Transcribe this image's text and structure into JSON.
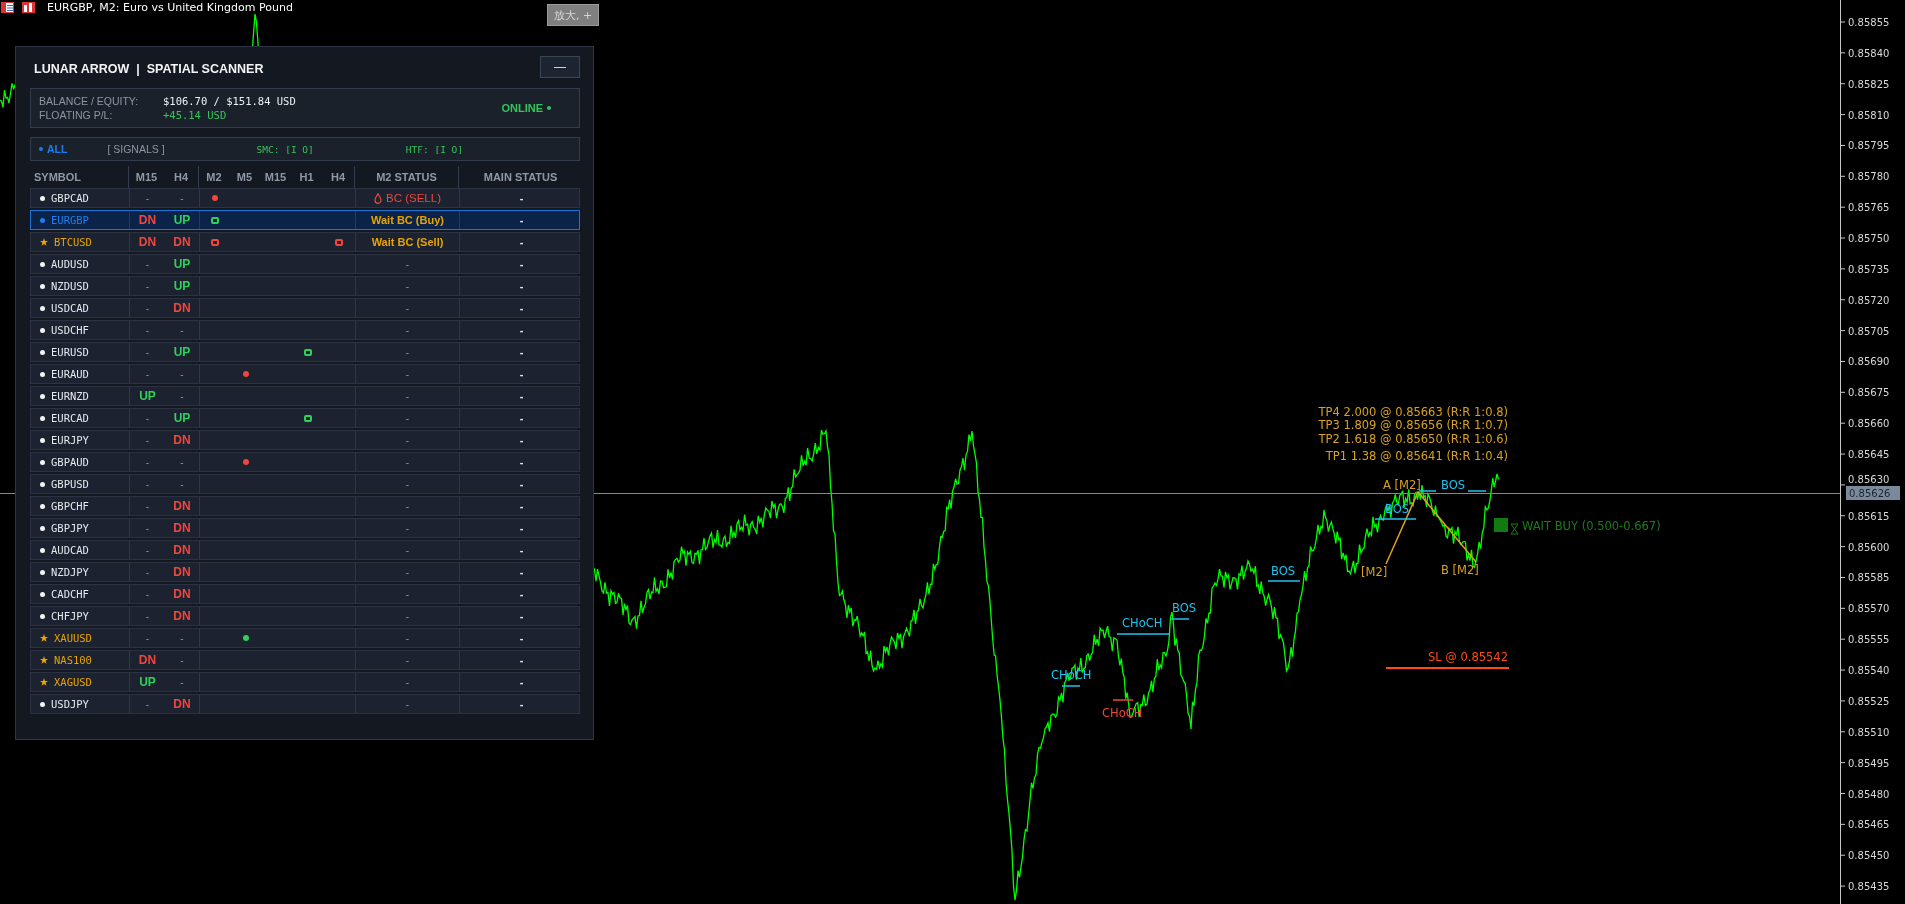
{
  "window": {
    "title": "EURGBP, M2:  Euro vs United Kingdom Pound",
    "zoom_button": "放大, +"
  },
  "scanner": {
    "title": "LUNAR ARROW  |  SPATIAL SCANNER",
    "minimize": "—",
    "account": {
      "balance_label": "BALANCE / EQUITY:",
      "balance_value": "$106.70 / $151.84 USD",
      "pl_label": "FLOATING P/L:",
      "pl_value": "+45.14 USD",
      "status": "ONLINE"
    },
    "filters": [
      {
        "label": "ALL",
        "selected": true
      },
      {
        "label": "[ SIGNALS ]",
        "selected": false
      }
    ],
    "smc": "SMC: [I O]",
    "htf": "HTF: [I O]",
    "columns": [
      "SYMBOL",
      "M15",
      "H4",
      "M2",
      "M5",
      "M15",
      "H1",
      "H4",
      "M2 STATUS",
      "MAIN STATUS"
    ],
    "rows": [
      {
        "symbol": "GBPCAD",
        "kind": "dot",
        "selected": false,
        "m15": {
          "text": "-",
          "kind": "none"
        },
        "h4": {
          "text": "-",
          "kind": "none"
        },
        "signals": {
          "m2": {
            "kind": "filled",
            "color": "#f0463c"
          }
        },
        "status": {
          "text": "BC (SELL)",
          "kind": "sell"
        },
        "main": "-"
      },
      {
        "symbol": "EURGBP",
        "kind": "dot",
        "selected": true,
        "m15": {
          "text": "DN",
          "kind": "down"
        },
        "h4": {
          "text": "UP",
          "kind": "up"
        },
        "signals": {
          "m2": {
            "kind": "hollow",
            "color": "#2fd15a"
          }
        },
        "status": {
          "text": "Wait BC (Buy)",
          "kind": "wait"
        },
        "main": "-"
      },
      {
        "symbol": "BTCUSD",
        "kind": "star",
        "selected": false,
        "m15": {
          "text": "DN",
          "kind": "down"
        },
        "h4": {
          "text": "DN",
          "kind": "down"
        },
        "signals": {
          "m2": {
            "kind": "hollow",
            "color": "#f0463c"
          },
          "h4": {
            "kind": "hollow",
            "color": "#f0463c"
          }
        },
        "status": {
          "text": "Wait BC (Sell)",
          "kind": "wait"
        },
        "main": "-"
      },
      {
        "symbol": "AUDUSD",
        "kind": "dot",
        "selected": false,
        "m15": {
          "text": "-",
          "kind": "none"
        },
        "h4": {
          "text": "UP",
          "kind": "up"
        },
        "signals": {},
        "status": {
          "text": "-",
          "kind": "none"
        },
        "main": "-"
      },
      {
        "symbol": "NZDUSD",
        "kind": "dot",
        "selected": false,
        "m15": {
          "text": "-",
          "kind": "none"
        },
        "h4": {
          "text": "UP",
          "kind": "up"
        },
        "signals": {},
        "status": {
          "text": "-",
          "kind": "none"
        },
        "main": "-"
      },
      {
        "symbol": "USDCAD",
        "kind": "dot",
        "selected": false,
        "m15": {
          "text": "-",
          "kind": "none"
        },
        "h4": {
          "text": "DN",
          "kind": "down"
        },
        "signals": {},
        "status": {
          "text": "-",
          "kind": "none"
        },
        "main": "-"
      },
      {
        "symbol": "USDCHF",
        "kind": "dot",
        "selected": false,
        "m15": {
          "text": "-",
          "kind": "none"
        },
        "h4": {
          "text": "-",
          "kind": "none"
        },
        "signals": {},
        "status": {
          "text": "-",
          "kind": "none"
        },
        "main": "-"
      },
      {
        "symbol": "EURUSD",
        "kind": "dot",
        "selected": false,
        "m15": {
          "text": "-",
          "kind": "none"
        },
        "h4": {
          "text": "UP",
          "kind": "up"
        },
        "signals": {
          "h1": {
            "kind": "hollow",
            "color": "#2fd15a"
          }
        },
        "status": {
          "text": "-",
          "kind": "none"
        },
        "main": "-"
      },
      {
        "symbol": "EURAUD",
        "kind": "dot",
        "selected": false,
        "m15": {
          "text": "-",
          "kind": "none"
        },
        "h4": {
          "text": "-",
          "kind": "none"
        },
        "signals": {
          "m5": {
            "kind": "filled",
            "color": "#f0463c"
          }
        },
        "status": {
          "text": "-",
          "kind": "none"
        },
        "main": "-"
      },
      {
        "symbol": "EURNZD",
        "kind": "dot",
        "selected": false,
        "m15": {
          "text": "UP",
          "kind": "up"
        },
        "h4": {
          "text": "-",
          "kind": "none"
        },
        "signals": {},
        "status": {
          "text": "-",
          "kind": "none"
        },
        "main": "-"
      },
      {
        "symbol": "EURCAD",
        "kind": "dot",
        "selected": false,
        "m15": {
          "text": "-",
          "kind": "none"
        },
        "h4": {
          "text": "UP",
          "kind": "up"
        },
        "signals": {
          "h1": {
            "kind": "hollow",
            "color": "#2fd15a"
          }
        },
        "status": {
          "text": "-",
          "kind": "none"
        },
        "main": "-"
      },
      {
        "symbol": "EURJPY",
        "kind": "dot",
        "selected": false,
        "m15": {
          "text": "-",
          "kind": "none"
        },
        "h4": {
          "text": "DN",
          "kind": "down"
        },
        "signals": {},
        "status": {
          "text": "-",
          "kind": "none"
        },
        "main": "-"
      },
      {
        "symbol": "GBPAUD",
        "kind": "dot",
        "selected": false,
        "m15": {
          "text": "-",
          "kind": "none"
        },
        "h4": {
          "text": "-",
          "kind": "none"
        },
        "signals": {
          "m5": {
            "kind": "filled",
            "color": "#f0463c"
          }
        },
        "status": {
          "text": "-",
          "kind": "none"
        },
        "main": "-"
      },
      {
        "symbol": "GBPUSD",
        "kind": "dot",
        "selected": false,
        "m15": {
          "text": "-",
          "kind": "none"
        },
        "h4": {
          "text": "-",
          "kind": "none"
        },
        "signals": {},
        "status": {
          "text": "-",
          "kind": "none"
        },
        "main": "-"
      },
      {
        "symbol": "GBPCHF",
        "kind": "dot",
        "selected": false,
        "m15": {
          "text": "-",
          "kind": "none"
        },
        "h4": {
          "text": "DN",
          "kind": "down"
        },
        "signals": {},
        "status": {
          "text": "-",
          "kind": "none"
        },
        "main": "-"
      },
      {
        "symbol": "GBPJPY",
        "kind": "dot",
        "selected": false,
        "m15": {
          "text": "-",
          "kind": "none"
        },
        "h4": {
          "text": "DN",
          "kind": "down"
        },
        "signals": {},
        "status": {
          "text": "-",
          "kind": "none"
        },
        "main": "-"
      },
      {
        "symbol": "AUDCAD",
        "kind": "dot",
        "selected": false,
        "m15": {
          "text": "-",
          "kind": "none"
        },
        "h4": {
          "text": "DN",
          "kind": "down"
        },
        "signals": {},
        "status": {
          "text": "-",
          "kind": "none"
        },
        "main": "-"
      },
      {
        "symbol": "NZDJPY",
        "kind": "dot",
        "selected": false,
        "m15": {
          "text": "-",
          "kind": "none"
        },
        "h4": {
          "text": "DN",
          "kind": "down"
        },
        "signals": {},
        "status": {
          "text": "-",
          "kind": "none"
        },
        "main": "-"
      },
      {
        "symbol": "CADCHF",
        "kind": "dot",
        "selected": false,
        "m15": {
          "text": "-",
          "kind": "none"
        },
        "h4": {
          "text": "DN",
          "kind": "down"
        },
        "signals": {},
        "status": {
          "text": "-",
          "kind": "none"
        },
        "main": "-"
      },
      {
        "symbol": "CHFJPY",
        "kind": "dot",
        "selected": false,
        "m15": {
          "text": "-",
          "kind": "none"
        },
        "h4": {
          "text": "DN",
          "kind": "down"
        },
        "signals": {},
        "status": {
          "text": "-",
          "kind": "none"
        },
        "main": "-"
      },
      {
        "symbol": "XAUUSD",
        "kind": "star",
        "selected": false,
        "m15": {
          "text": "-",
          "kind": "none"
        },
        "h4": {
          "text": "-",
          "kind": "none"
        },
        "signals": {
          "m5": {
            "kind": "filled",
            "color": "#2fd15a"
          }
        },
        "status": {
          "text": "-",
          "kind": "none"
        },
        "main": "-"
      },
      {
        "symbol": "NAS100",
        "kind": "star",
        "selected": false,
        "m15": {
          "text": "DN",
          "kind": "down"
        },
        "h4": {
          "text": "-",
          "kind": "none"
        },
        "signals": {},
        "status": {
          "text": "-",
          "kind": "none"
        },
        "main": "-"
      },
      {
        "symbol": "XAGUSD",
        "kind": "star",
        "selected": false,
        "m15": {
          "text": "UP",
          "kind": "up"
        },
        "h4": {
          "text": "-",
          "kind": "none"
        },
        "signals": {},
        "status": {
          "text": "-",
          "kind": "none"
        },
        "main": "-"
      },
      {
        "symbol": "USDJPY",
        "kind": "dot",
        "selected": false,
        "m15": {
          "text": "-",
          "kind": "none"
        },
        "h4": {
          "text": "DN",
          "kind": "down"
        },
        "signals": {},
        "status": {
          "text": "-",
          "kind": "none"
        },
        "main": "-"
      }
    ]
  },
  "chart": {
    "annotations": [
      {
        "text": "TP4 2.000 @ 0.85663 (R:R 1:0.8)",
        "kind": "target"
      },
      {
        "text": "TP3 1.809 @ 0.85656 (R:R 1:0.7)",
        "kind": "target"
      },
      {
        "text": "TP2 1.618 @ 0.85650 (R:R 1:0.6)",
        "kind": "target"
      },
      {
        "text": "TP1 1.38 @ 0.85641 (R:R 1:0.4)",
        "kind": "target"
      },
      {
        "text": "A [M2]",
        "kind": "point"
      },
      {
        "text": "BOS",
        "kind": "structure"
      },
      {
        "text": "BOS",
        "kind": "structure"
      },
      {
        "text": "[M2]",
        "kind": "point"
      },
      {
        "text": "B [M2]",
        "kind": "point"
      },
      {
        "text": "WAIT BUY (0.500-0.667)",
        "kind": "signal"
      },
      {
        "text": "BOS",
        "kind": "structure"
      },
      {
        "text": "BOS",
        "kind": "structure"
      },
      {
        "text": "CHoCH",
        "kind": "structure"
      },
      {
        "text": "CHoCH",
        "kind": "structure"
      },
      {
        "text": "CHoCH",
        "kind": "structure_bearish"
      },
      {
        "text": "SL @ 0.85542",
        "kind": "stop"
      }
    ],
    "price_axis": {
      "labels": [
        "0.85855",
        "0.85840",
        "0.85825",
        "0.85810",
        "0.85795",
        "0.85780",
        "0.85765",
        "0.85750",
        "0.85735",
        "0.85720",
        "0.85705",
        "0.85690",
        "0.85675",
        "0.85660",
        "0.85645",
        "0.85630",
        "0.85615",
        "0.85600",
        "0.85585",
        "0.85570",
        "0.85555",
        "0.85540",
        "0.85525",
        "0.85510",
        "0.85495",
        "0.85480",
        "0.85465",
        "0.85450",
        "0.85435"
      ],
      "current": "0.85626"
    }
  }
}
